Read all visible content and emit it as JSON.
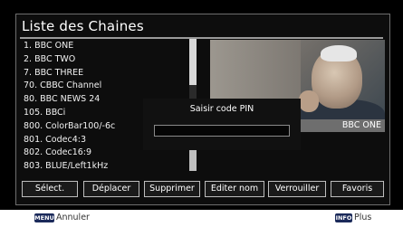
{
  "title": "Liste des Chaines",
  "channels": [
    "1. BBC ONE",
    "2. BBC TWO",
    "7. BBC THREE",
    "70. CBBC Channel",
    "80. BBC NEWS 24",
    "105. BBCi",
    "800. ColorBar100/-6c",
    "801. Codec4:3",
    "802. Codec16:9",
    "803. BLUE/Left1kHz"
  ],
  "preview": {
    "channel_name": "BBC ONE"
  },
  "pin_dialog": {
    "label": "Saisir code PIN",
    "value": ""
  },
  "buttons": {
    "select": "Sélect.",
    "move": "Déplacer",
    "delete": "Supprimer",
    "edit_name": "Editer nom",
    "lock": "Verrouiller",
    "favorites": "Favoris"
  },
  "footer": {
    "menu_key": "MENU",
    "menu_action": "Annuler",
    "info_key": "INFO",
    "info_action": "Plus"
  },
  "colors": {
    "background": "#000000",
    "badge": "#6e6e6e",
    "remote_key": "#1b2a5a"
  }
}
